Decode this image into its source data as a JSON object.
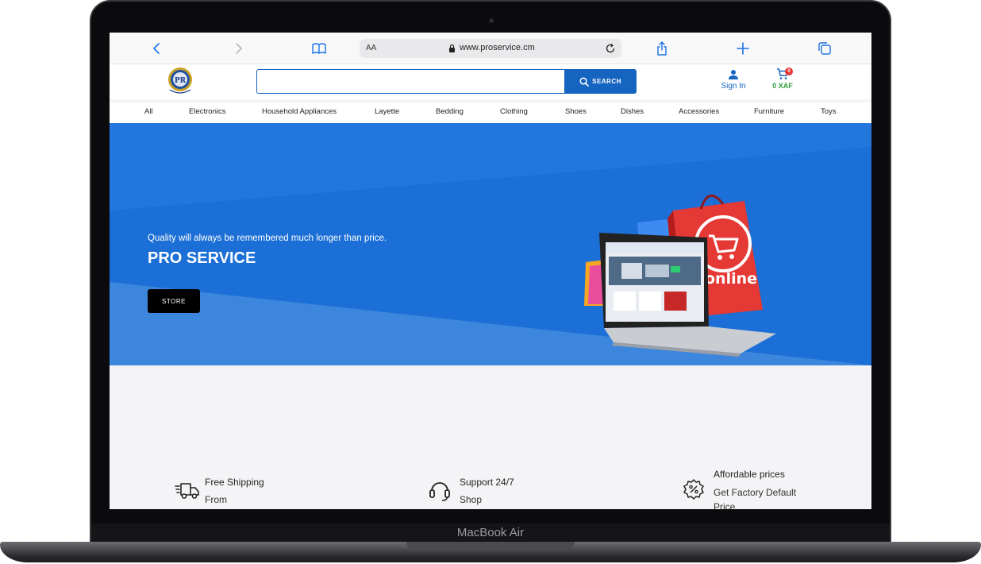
{
  "device": {
    "brand_label": "MacBook Air"
  },
  "browser": {
    "address_aa": "AA",
    "url": "www.proservice.cm",
    "icons": [
      "back-icon",
      "forward-icon",
      "bookmarks-icon",
      "lock-icon",
      "reload-icon",
      "share-icon",
      "new-tab-icon",
      "tabs-icon"
    ]
  },
  "header": {
    "search_placeholder": "",
    "search_button_label": "SEARCH",
    "signin_label": "Sign In",
    "cart_count": "0",
    "cart_total": "0 XAF"
  },
  "categories": [
    "All",
    "Electronics",
    "Household Appliances",
    "Layette",
    "Bedding",
    "Clothing",
    "Shoes",
    "Dishes",
    "Accessories",
    "Furniture",
    "Toys"
  ],
  "hero": {
    "tagline": "Quality will always be remembered much longer than price.",
    "title": "PRO SERVICE",
    "store_button": "STORE",
    "bag_text": "online"
  },
  "features": [
    {
      "title": "Free Shipping",
      "subtitle": "From all orders",
      "icon": "truck-icon"
    },
    {
      "title": "Support 24/7",
      "subtitle": "Shop with an expert",
      "icon": "headset-icon"
    },
    {
      "title": "Affordable prices",
      "subtitle": "Get Factory Default Price",
      "icon": "discount-badge-icon"
    }
  ],
  "colors": {
    "brand_blue": "#1565c0",
    "hero_blue": "#1b6fd6",
    "cart_total_green": "#2e9e3a",
    "badge_red": "#e53935"
  }
}
